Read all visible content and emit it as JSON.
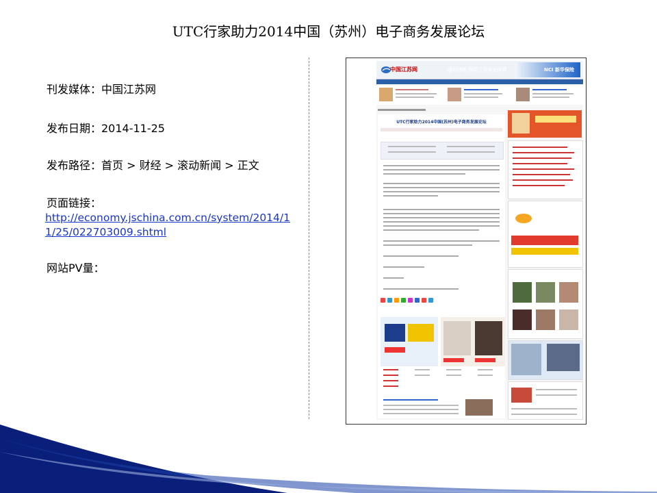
{
  "title": "UTC行家助力2014中国（苏州）电子商务发展论坛",
  "fields": {
    "media": "刊发媒体：中国江苏网",
    "date": "发布日期：2014-11-25",
    "path": "发布路径：首页 > 财经 > 滚动新闻 > 正文",
    "link_label": "页面链接：",
    "link_url": "http://economy.jschina.com.cn/system/2014/11/25/022703009.shtml",
    "pv": "网站PV量："
  },
  "screenshot": {
    "logo_text": "中国江苏网",
    "banner_text": "随时随地 畅享江苏安全保障",
    "ad_text": "NCI 新华保险",
    "article_title": "UTC行家助力2014中国(苏州)电子商务发展论坛"
  },
  "colors": {
    "accent_blue": "#2b5fa8",
    "link_blue": "#1a35c8",
    "footer_navy": "#0a1f7a"
  }
}
